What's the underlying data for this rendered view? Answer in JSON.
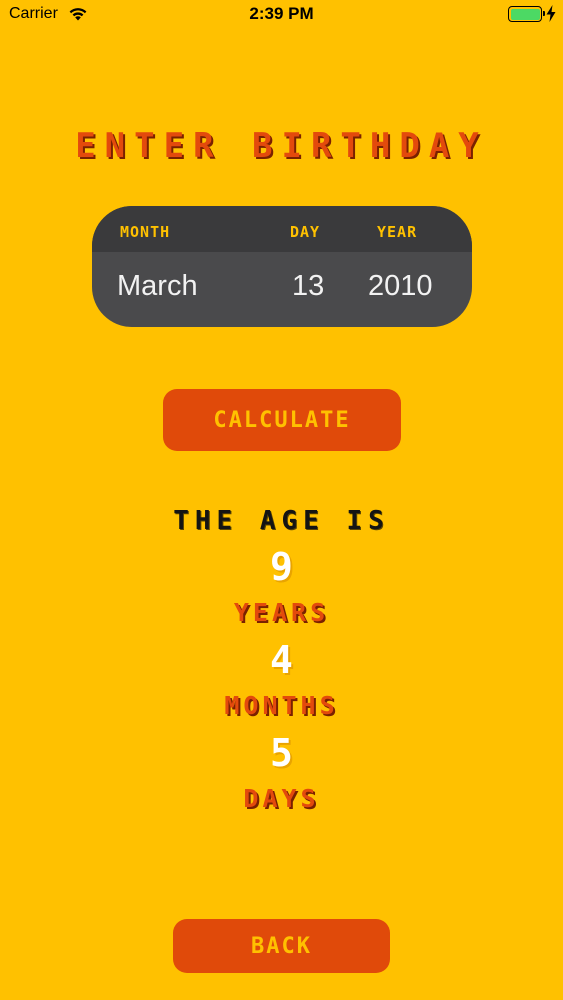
{
  "status_bar": {
    "carrier": "Carrier",
    "time": "2:39 PM",
    "battery_color": "#4CD964"
  },
  "title": "ENTER BIRTHDAY",
  "picker": {
    "columns": [
      {
        "label": "MONTH",
        "value": "March"
      },
      {
        "label": "DAY",
        "value": "13"
      },
      {
        "label": "YEAR",
        "value": "2010"
      }
    ]
  },
  "calculate_label": "CALCULATE",
  "result": {
    "heading": "THE AGE IS",
    "years": "9",
    "years_label": "YEARS",
    "months": "4",
    "months_label": "MONTHS",
    "days": "5",
    "days_label": "DAYS"
  },
  "back_label": "BACK",
  "colors": {
    "background": "#FFC100",
    "accent": "#E04A0A",
    "picker_bg": "#4A4A4C"
  },
  "icons": [
    "wifi-icon",
    "battery-icon",
    "charging-icon"
  ]
}
